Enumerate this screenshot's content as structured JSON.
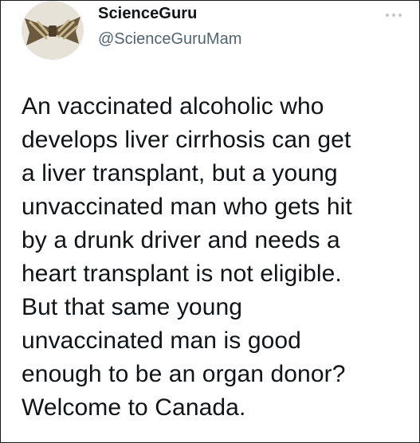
{
  "author": {
    "display_name": "ScienceGuru",
    "handle": "@ScienceGuruMam",
    "avatar_icon": "bow-tie-avatar"
  },
  "tweet": {
    "lines": [
      "An vaccinated alcoholic who",
      "develops liver cirrhosis can get",
      "a liver transplant, but a young",
      "unvaccinated man who gets hit",
      "by a drunk driver and needs a",
      "heart transplant is not eligible.",
      "But that same young",
      "unvaccinated man is good",
      "enough to be an organ donor?",
      "Welcome to Canada."
    ]
  },
  "menu_icon": "more-options-icon",
  "colors": {
    "text": "#0f1419",
    "secondary": "#536471",
    "border": "#1a1a1a"
  }
}
